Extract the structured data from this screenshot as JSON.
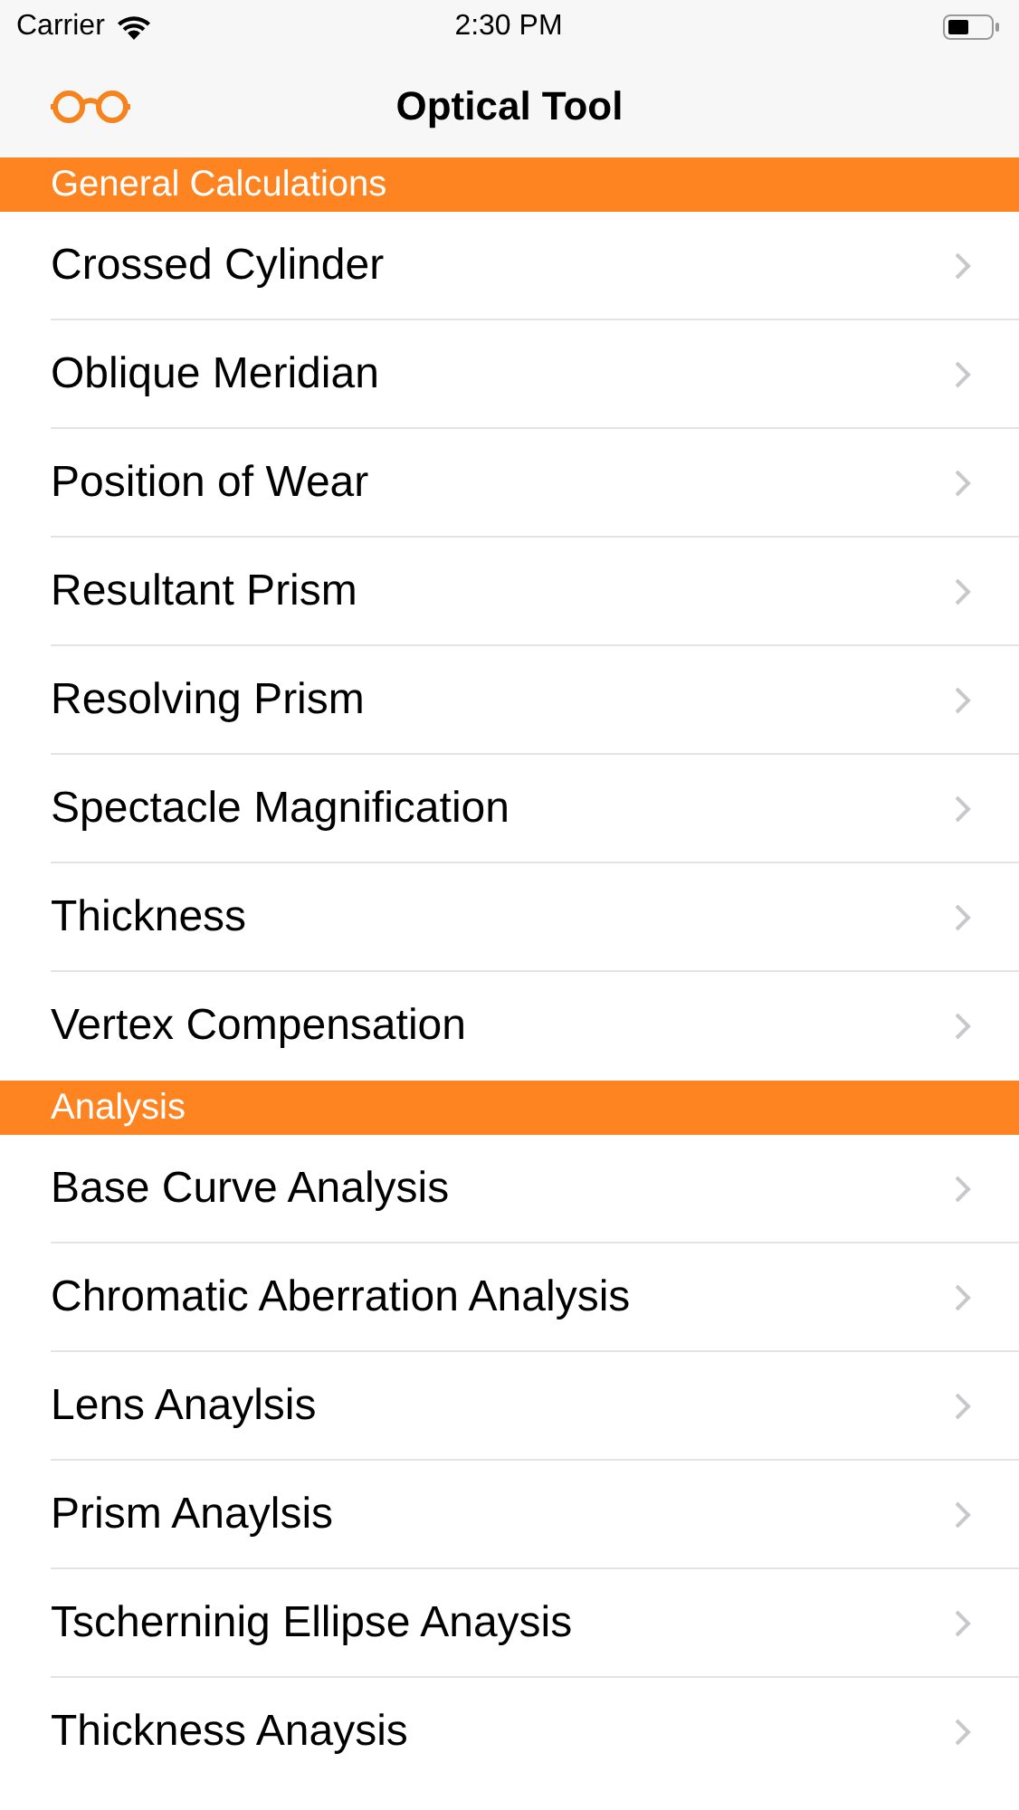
{
  "status_bar": {
    "carrier": "Carrier",
    "time": "2:30 PM"
  },
  "nav_bar": {
    "title": "Optical Tool"
  },
  "sections": [
    {
      "header": "General Calculations",
      "items": [
        "Crossed Cylinder",
        "Oblique Meridian",
        "Position of Wear",
        "Resultant Prism",
        "Resolving Prism",
        "Spectacle Magnification",
        "Thickness",
        "Vertex Compensation"
      ]
    },
    {
      "header": "Analysis",
      "items": [
        "Base Curve Analysis",
        "Chromatic Aberration Analysis",
        "Lens Anaylsis",
        "Prism Anaylsis",
        "Tscherninig Ellipse Anaysis",
        "Thickness Anaysis"
      ]
    }
  ]
}
